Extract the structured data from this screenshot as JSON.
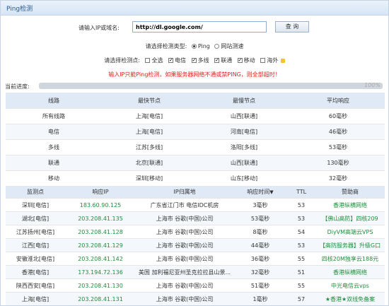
{
  "title": "Ping检测",
  "form": {
    "url_label": "请输入IP或域名:",
    "url_value": "http://dl.google.com/",
    "query_label": "查 询",
    "type_label": "请选择检测类型:",
    "type_options": [
      "Ping",
      "网站测速"
    ],
    "points_label": "请选择检测点:",
    "points_options": [
      "全选",
      "电信",
      "多线",
      "联通",
      "移动",
      "海外"
    ],
    "warning": "输入IP只能Ping检测，如果服务器网络不通或禁PING，则全部超时！"
  },
  "progress": {
    "label": "当前进度:",
    "value": 100,
    "text": "100%"
  },
  "summary": {
    "headers": [
      "线路",
      "最快节点",
      "最慢节点",
      "平均响应"
    ],
    "rows": [
      [
        "所有线路",
        "上海[电信]",
        "山西[联通]",
        "60毫秒"
      ],
      [
        "电信",
        "上海[电信]",
        "河南[电信]",
        "46毫秒"
      ],
      [
        "多线",
        "江苏[多线]",
        "洛阳[多线]",
        "53毫秒"
      ],
      [
        "联通",
        "北京[联通]",
        "山西[联通]",
        "130毫秒"
      ],
      [
        "移动",
        "深圳[移动]",
        "山东[移动]",
        "32毫秒"
      ]
    ]
  },
  "results": {
    "headers": [
      "监测点",
      "响应IP",
      "IP归属地",
      "响应时间",
      "TTL",
      "赞助商"
    ],
    "sort_icon": "▼",
    "rows": [
      [
        "深圳[电信]",
        "183.60.90.125",
        "广东省江门市 电信IDC机房",
        "3毫秒",
        "53",
        "香港纵横网络"
      ],
      [
        "湖北[电信]",
        "203.208.41.135",
        "上海市 谷歌(中国)公司",
        "53毫秒",
        "53",
        "【佛山高防】四核209"
      ],
      [
        "江苏扬州[电信]",
        "203.208.41.128",
        "上海市 谷歌(中国)公司",
        "8毫秒",
        "54",
        "DiyVM高端云VPS"
      ],
      [
        "江西[电信]",
        "203.208.41.129",
        "上海市 谷歌(中国)公司",
        "44毫秒",
        "53",
        "【高防服务器】升级G口"
      ],
      [
        "安徽淮北[电信]",
        "203.208.41.142",
        "上海市 谷歌(中国)公司",
        "36毫秒",
        "55",
        "四核20M独享云188元"
      ],
      [
        "香港[电信]",
        "173.194.72.136",
        "美国 加利福尼亚州圣克拉拉县山景...",
        "32毫秒",
        "51",
        "香港纵横网络"
      ],
      [
        "陕西西安[电信]",
        "203.208.41.130",
        "上海市 谷歌(中国)公司",
        "51毫秒",
        "55",
        "中光电信云vps"
      ],
      [
        "上海[电信]",
        "203.208.41.131",
        "上海市 谷歌(中国)公司",
        "1毫秒",
        "57",
        "★香港★双线免备案"
      ]
    ]
  }
}
